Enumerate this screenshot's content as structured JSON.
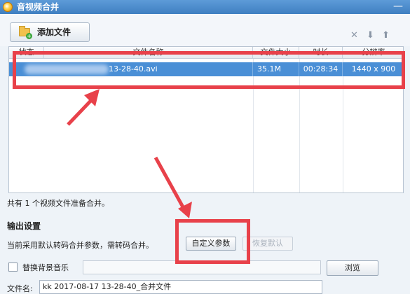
{
  "window": {
    "title": "音视频合并",
    "close_glyph": "—"
  },
  "toolbar": {
    "add_file_label": "添加文件",
    "icons": [
      "folder-add-icon",
      "delete-icon",
      "move-down-icon",
      "move-up-icon"
    ],
    "delete_glyph": "✕",
    "down_glyph": "⬇",
    "up_glyph": "⬆"
  },
  "table": {
    "columns": [
      "状态",
      "文件名称",
      "文件大小",
      "时长",
      "分辨率"
    ],
    "rows": [
      {
        "filename": "13-28-40.avi",
        "size": "35.1M",
        "duration": "00:28:34",
        "resolution": "1440 x 900"
      }
    ]
  },
  "status_text": "共有 1 个视频文件准备合并。",
  "output_settings": {
    "title": "输出设置",
    "current_info": "当前采用默认转码合并参数，需转码合并。",
    "custom_button": "自定义参数",
    "restore_button": "恢复默认"
  },
  "background_music": {
    "label": "替换背景音乐",
    "checked": false,
    "browse_button": "浏览"
  },
  "file_name": {
    "label": "文件名:",
    "value": "kk 2017-08-17 13-28-40_合并文件"
  },
  "colors": {
    "annotation": "#e8414a",
    "selection": "#4a8fd6",
    "titlebar": "#4f8fd0"
  }
}
